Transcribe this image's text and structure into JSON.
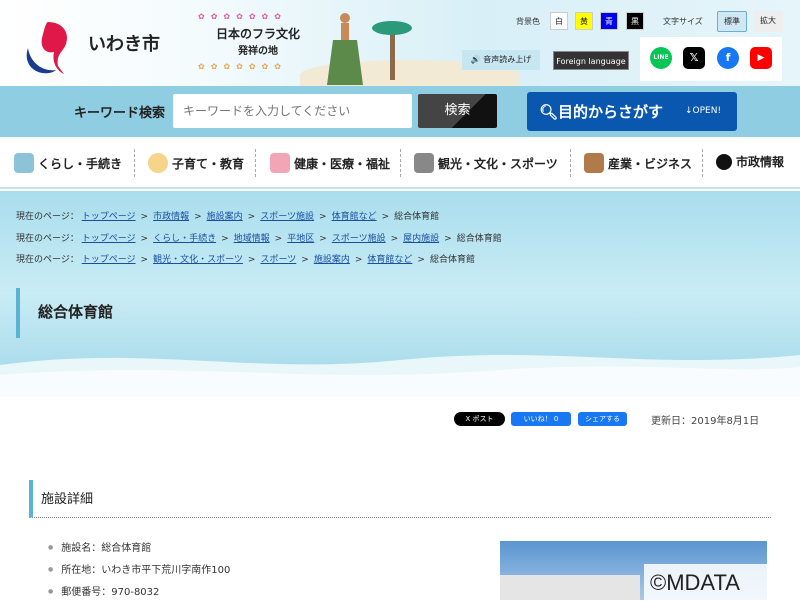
{
  "header": {
    "logo_text": "いわき市",
    "banner_line1": "日本のフラ文化",
    "banner_line2": "発祥の地",
    "bg_label": "背景色",
    "bg_colors": [
      {
        "label": "白",
        "bg": "#ffffff",
        "fg": "#000000"
      },
      {
        "label": "黄",
        "bg": "#ffff00",
        "fg": "#000000"
      },
      {
        "label": "青",
        "bg": "#0000ee",
        "fg": "#ffffff"
      },
      {
        "label": "黒",
        "bg": "#000000",
        "fg": "#ffffff"
      }
    ],
    "font_label": "文字サイズ",
    "font_standard": "標準",
    "font_large": "拡大",
    "voice": "音声読み上げ",
    "foreign": "Foreign language",
    "social": [
      "LINE",
      "X",
      "Facebook",
      "YouTube"
    ]
  },
  "search": {
    "label": "キーワード検索",
    "placeholder": "キーワードを入力してください",
    "button": "検索",
    "purpose": "目的からさがす",
    "open": "↓OPEN!"
  },
  "nav": [
    "くらし・手続き",
    "子育て・教育",
    "健康・医療・福祉",
    "観光・文化・スポーツ",
    "産業・ビジネス",
    "市政情報"
  ],
  "breadcrumbs": [
    {
      "prefix": "現在のページ：",
      "links": [
        "トップページ",
        "市政情報",
        "施設案内",
        "スポーツ施設",
        "体育館など"
      ],
      "current": "総合体育館"
    },
    {
      "prefix": "現在のページ：",
      "links": [
        "トップページ",
        "くらし・手続き",
        "地域情報",
        "平地区",
        "スポーツ施設",
        "屋内施設"
      ],
      "current": "総合体育館"
    },
    {
      "prefix": "現在のページ：",
      "links": [
        "トップページ",
        "観光・文化・スポーツ",
        "スポーツ",
        "施設案内",
        "体育館など"
      ],
      "current": "総合体育館"
    }
  ],
  "page_title": "総合体育館",
  "share": {
    "x_post": "X ポスト",
    "like": "いいね！ 0",
    "share": "シェアする"
  },
  "updated": "更新日：2019年8月1日",
  "section_title": "施設詳細",
  "details": [
    "施設名：総合体育館",
    "所在地：いわき市平下荒川字南作100",
    "郵便番号：970-8032"
  ],
  "watermark": "©MDATA"
}
